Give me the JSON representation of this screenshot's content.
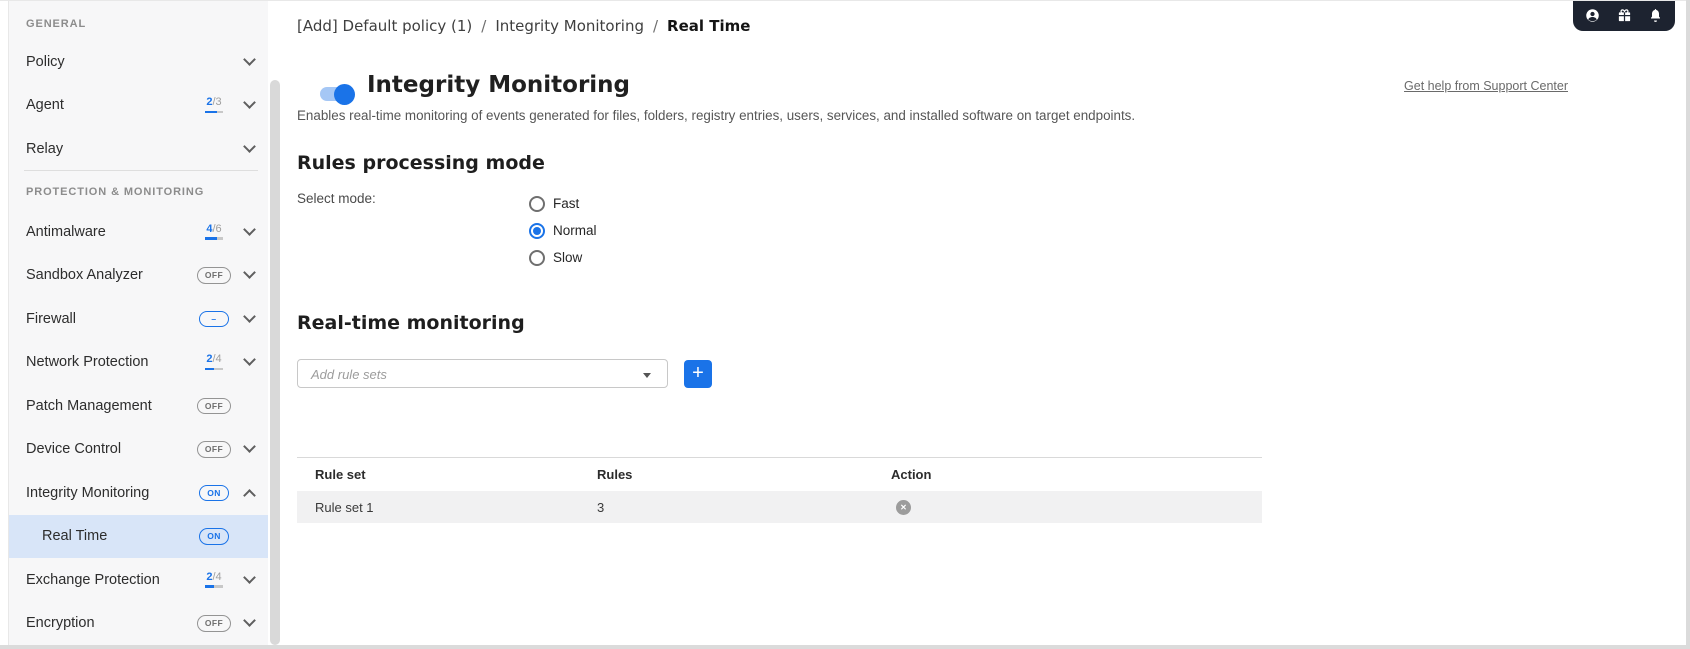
{
  "colors": {
    "accent": "#1a73e8",
    "topbar_badge_bg": "#1d2330",
    "selected_item_bg": "#d8e5f8",
    "table_row_bg": "#f1f1f2",
    "sidebar_bg": "#f7f7f8"
  },
  "sidebar": {
    "sections": [
      {
        "title": "GENERAL",
        "items": [
          {
            "label": "Policy",
            "chevron": "down"
          },
          {
            "label": "Agent",
            "badge_num": "2",
            "badge_den": "/3",
            "badge_pct": "67%",
            "chevron": "down"
          },
          {
            "label": "Relay",
            "chevron": "down"
          }
        ]
      },
      {
        "title": "PROTECTION & MONITORING",
        "items": [
          {
            "label": "Antimalware",
            "badge_num": "4",
            "badge_den": "/6",
            "badge_pct": "67%",
            "chevron": "down"
          },
          {
            "label": "Sandbox Analyzer",
            "badge": "OFF",
            "chevron": "down"
          },
          {
            "label": "Firewall",
            "badge": "–",
            "chevron": "down"
          },
          {
            "label": "Network Protection",
            "badge_num": "2",
            "badge_den": "/4",
            "badge_pct": "50%",
            "chevron": "down"
          },
          {
            "label": "Patch Management",
            "badge": "OFF"
          },
          {
            "label": "Device Control",
            "badge": "OFF",
            "chevron": "down"
          },
          {
            "label": "Integrity Monitoring",
            "badge": "ON",
            "chevron": "up"
          },
          {
            "label": "Real Time",
            "badge": "ON",
            "selected": true,
            "indented": true
          },
          {
            "label": "Exchange Protection",
            "badge_num": "2",
            "badge_den": "/4",
            "badge_pct": "50%",
            "chevron": "down"
          },
          {
            "label": "Encryption",
            "badge": "OFF",
            "chevron": "down"
          }
        ]
      }
    ]
  },
  "topbar": {
    "icons": [
      "user-icon",
      "gift-icon",
      "bell-icon"
    ]
  },
  "breadcrumb": {
    "separator": "/",
    "items": [
      "[Add] Default policy (1)",
      "Integrity Monitoring",
      "Real Time"
    ]
  },
  "help_link": "Get help from Support Center",
  "page": {
    "title": "Integrity Monitoring",
    "toggle": "on",
    "description": "Enables real-time monitoring of events generated for files, folders, registry entries, users, services, and installed software on target endpoints."
  },
  "rules_mode": {
    "heading": "Rules processing mode",
    "label": "Select mode:",
    "options": [
      {
        "label": "Fast",
        "selected": false
      },
      {
        "label": "Normal",
        "selected": true
      },
      {
        "label": "Slow",
        "selected": false
      }
    ]
  },
  "realtime": {
    "heading": "Real-time monitoring",
    "dropdown_placeholder": "Add rule sets",
    "add_button": "+",
    "table": {
      "columns": [
        "Rule set",
        "Rules",
        "Action"
      ],
      "rows": [
        {
          "rule_set": "Rule set 1",
          "rules": "3",
          "action": "remove"
        }
      ]
    }
  }
}
